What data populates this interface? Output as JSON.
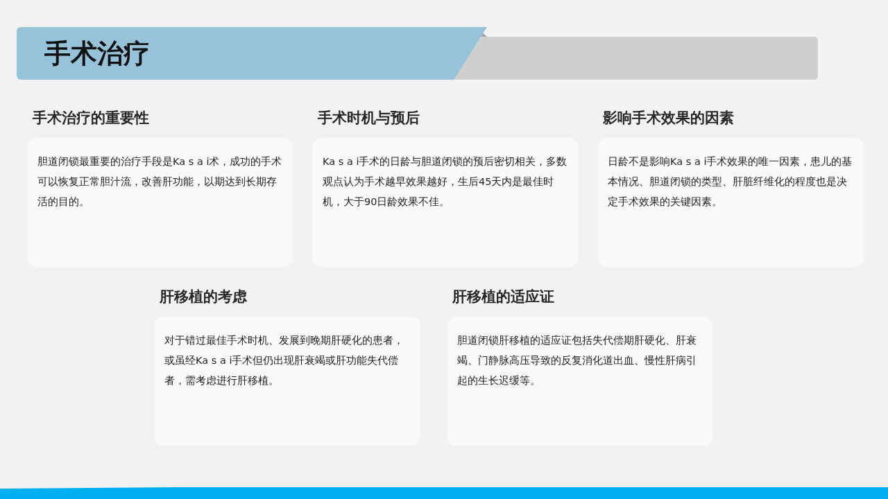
{
  "slide": {
    "title": "手术治疗"
  },
  "rows": [
    [
      {
        "heading": "手术治疗的重要性",
        "text": "胆道闭锁最重要的治疗手段是Ka s a i术，成功的手术可以恢复正常胆汁流，改善肝功能，以期达到长期存活的目的。"
      },
      {
        "heading": "手术时机与预后",
        "text": "Ka s a i手术的日龄与胆道闭锁的预后密切相关，多数观点认为手术越早效果越好，生后45天内是最佳时机，大于90日龄效果不佳。"
      },
      {
        "heading": "影响手术效果的因素",
        "text": "日龄不是影响Ka s a i手术效果的唯一因素，患儿的基本情况、胆道闭锁的类型、肝脏纤维化的程度也是决定手术效果的关键因素。"
      }
    ],
    [
      {
        "heading": "肝移植的考虑",
        "text": "对于错过最佳手术时机、发展到晚期肝硬化的患者，或虽经Ka s a i手术但仍出现肝衰竭或肝功能失代偿者，需考虑进行肝移植。"
      },
      {
        "heading": "肝移植的适应证",
        "text": "胆道闭锁肝移植的适应证包括失代偿期肝硬化、肝衰竭、门静脉高压导致的反复消化道出血、慢性肝病引起的生长迟缓等。"
      }
    ]
  ]
}
